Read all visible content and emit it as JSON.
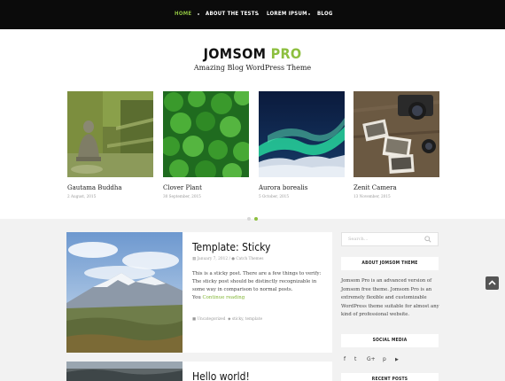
{
  "nav": {
    "items": [
      {
        "label": "HOME",
        "active": true
      },
      {
        "label": "ABOUT THE TESTS",
        "active": false
      },
      {
        "label": "LOREM IPSUM",
        "active": false
      },
      {
        "label": "BLOG",
        "active": false
      }
    ]
  },
  "site": {
    "title_main": "JOMSOM",
    "title_accent": "PRO",
    "tagline": "Amazing Blog WordPress Theme"
  },
  "slider": {
    "slides": [
      {
        "title": "Gautama Buddha",
        "date": "2 August, 2015"
      },
      {
        "title": "Clover Plant",
        "date": "30 September, 2015"
      },
      {
        "title": "Aurora borealis",
        "date": "5 October, 2015"
      },
      {
        "title": "Zenit Camera",
        "date": "13 November, 2015"
      }
    ],
    "dots": {
      "count": 2,
      "active_index": 1
    }
  },
  "posts": [
    {
      "title": "Template: Sticky",
      "date": "January 7, 2012",
      "author": "Catch Themes",
      "excerpt": "This is a sticky post. There are a few things to verify: The sticky post should be distinctly recognizable in some way in comparison to normal posts.",
      "read_more_prefix": "You",
      "read_more": "Continue reading",
      "category": "Uncategorized",
      "tags": "sticky, template"
    },
    {
      "title": "Hello world!"
    }
  ],
  "sidebar": {
    "search_placeholder": "Search...",
    "about_title": "ABOUT JOMSOM THEME",
    "about_text": "Jomsom Pro is an advanced version of Jomsom free theme. Jomsom Pro is an extremely flexible and customizable WordPress theme suitable for almost any kind of professional website.",
    "social_title": "SOCIAL MEDIA",
    "social_icons": [
      {
        "name": "facebook-icon",
        "glyph": "f"
      },
      {
        "name": "twitter-icon",
        "glyph": "t"
      },
      {
        "name": "google-plus-icon",
        "glyph": "G+"
      },
      {
        "name": "pinterest-icon",
        "glyph": "p"
      },
      {
        "name": "youtube-icon",
        "glyph": "▶"
      }
    ],
    "recent_posts_title": "RECENT POSTS"
  },
  "colors": {
    "accent": "#8dbf3f",
    "nav_bg": "#0b0b0b",
    "page_bg": "#f2f2f2"
  }
}
